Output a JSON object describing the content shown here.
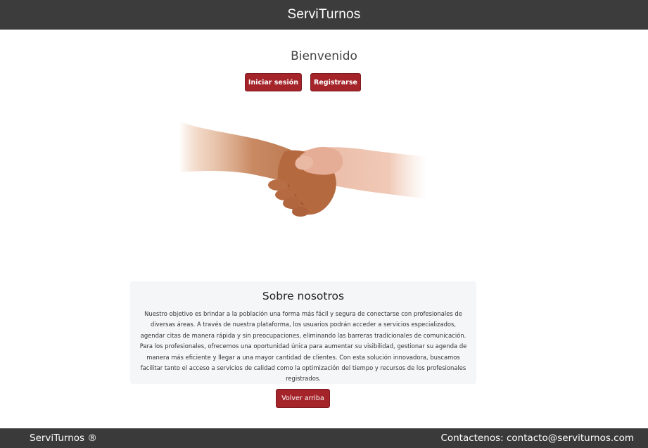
{
  "header": {
    "title": "ServiTurnos"
  },
  "welcome": {
    "title": "Bienvenido"
  },
  "actions": {
    "login_label": "Iniciar sesión",
    "register_label": "Registrarse"
  },
  "hero": {
    "icon": "handshake-image"
  },
  "about": {
    "title": "Sobre nosotros",
    "text": "Nuestro objetivo es brindar a la población una forma más fácil y segura de conectarse con profesionales de diversas áreas. A través de nuestra plataforma, los usuarios podrán acceder a servicios especializados, agendar citas de manera rápida y sin preocupaciones, eliminando las barreras tradicionales de comunicación. Para los profesionales, ofrecemos una oportunidad única para aumentar su visibilidad, gestionar su agenda de manera más eficiente y llegar a una mayor cantidad de clientes. Con esta solución innovadora, buscamos facilitar tanto el acceso a servicios de calidad como la optimización del tiempo y recursos de los profesionales registrados."
  },
  "back_to_top": {
    "label": "Volver arriba"
  },
  "footer": {
    "brand": "ServiTurnos ®",
    "contact": "Contactenos: contacto@serviturnos.com"
  },
  "colors": {
    "header_bg": "#3c3c3c",
    "accent": "#a4242a",
    "about_bg": "#f5f6f8",
    "footer_bg": "#3a3a3a"
  }
}
